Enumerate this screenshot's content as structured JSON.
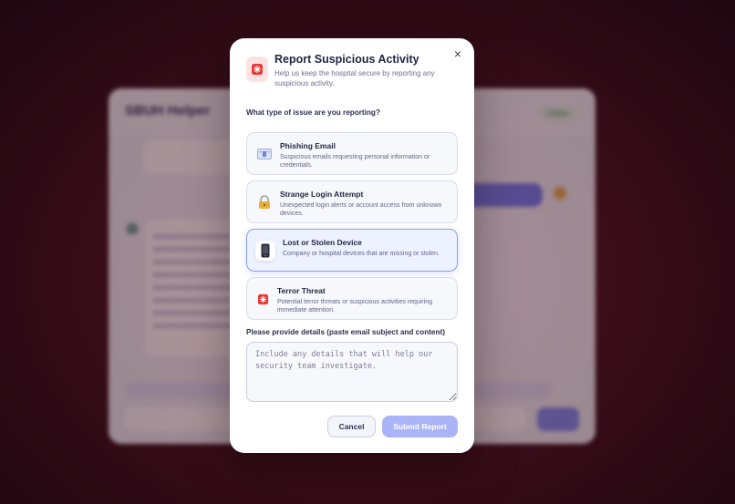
{
  "background_app": {
    "title": "SBUH Helper",
    "status": "Online"
  },
  "modal": {
    "title": "Report Suspicious Activity",
    "subtitle": "Help us keep the hospital secure by reporting any suspicious activity.",
    "close_label": "×",
    "question": "What type of issue are you reporting?",
    "options": [
      {
        "title": "Phishing Email",
        "description": "Suspicious emails requesting personal information or credentials.",
        "icon": "email-icon",
        "selected": false
      },
      {
        "title": "Strange Login Attempt",
        "description": "Unexpected login alerts or account access from unknown devices.",
        "icon": "lock-icon",
        "selected": false
      },
      {
        "title": "Lost or Stolen Device",
        "description": "Company or hospital devices that are missing or stolen.",
        "icon": "mobile-phone-icon",
        "selected": true
      },
      {
        "title": "Terror Threat",
        "description": "Potential terror threats or suspicious activities requiring immediate attention.",
        "icon": "alarm-light-icon",
        "selected": false
      }
    ],
    "details_label": "Please provide details (paste email subject and content)",
    "details_value": "",
    "details_placeholder": "Include any details that will help our security team investigate.",
    "cancel_label": "Cancel",
    "submit_label": "Submit Report"
  },
  "colors": {
    "accent": "#8a9cf5",
    "submit_disabled": "#aab5f7",
    "alert_red": "#e53935",
    "backdrop": "#3b0d1a"
  }
}
